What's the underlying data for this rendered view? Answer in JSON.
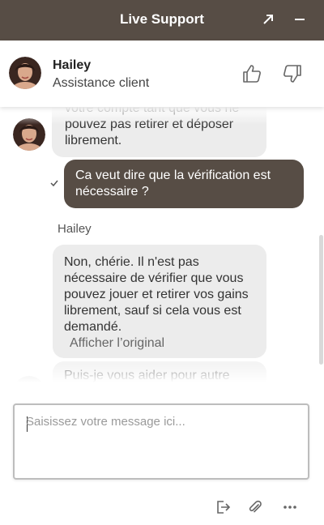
{
  "window": {
    "title": "Live Support",
    "expand_icon": "arrow-up-right-icon",
    "minimize_icon": "minimize-icon"
  },
  "agent": {
    "name": "Hailey",
    "role": "Assistance client",
    "avatar_icon": "agent-avatar",
    "rate_up_icon": "thumbs-up-icon",
    "rate_down_icon": "thumbs-down-icon"
  },
  "messages": [
    {
      "from": "agent",
      "lines": [
        "votre compte tant que vous ne",
        "pouvez pas retirer et déposer",
        "librement."
      ]
    },
    {
      "from": "user",
      "text": "Ca veut dire que la vérification est nécessaire ?",
      "status_icon": "check-icon"
    },
    {
      "from": "agent",
      "sender": "Hailey",
      "text": "Non, chérie. Il n'est pas nécessaire de vérifier que vous pouvez jouer et retirer vos gains librement, sauf si cela vous est demandé.",
      "show_original": "Afficher l’original"
    },
    {
      "from": "agent",
      "text": "Puis-je vous aider pour autre"
    }
  ],
  "composer": {
    "placeholder": "Saisissez votre message ici...",
    "value": ""
  },
  "actions": {
    "end_chat_icon": "exit-icon",
    "attach_icon": "paperclip-icon",
    "more_icon": "more-dots-icon"
  },
  "colors": {
    "brand": "#574d45",
    "agent_bubble": "#ececec",
    "user_bubble": "#574d45"
  }
}
